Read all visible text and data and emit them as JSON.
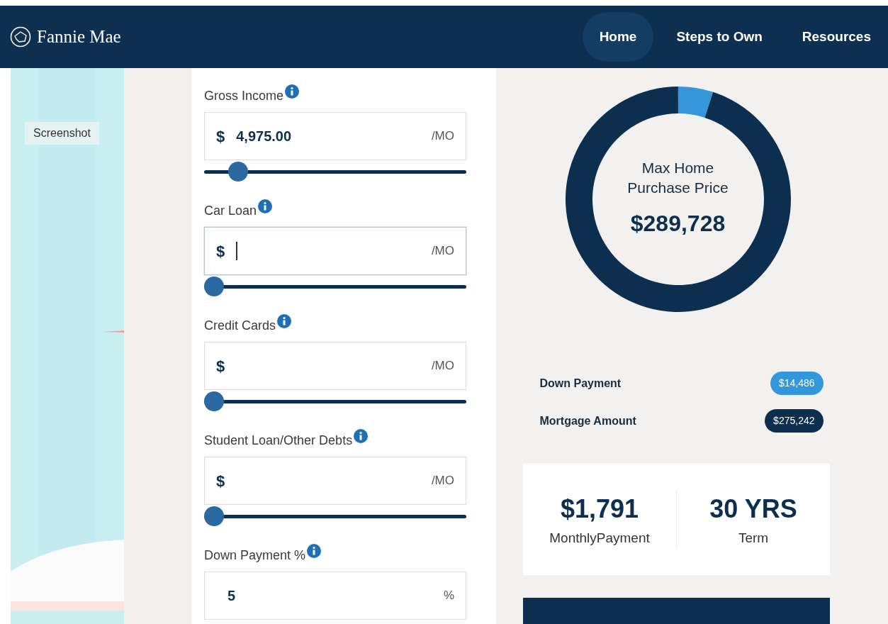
{
  "header": {
    "logo": "Fannie Mae",
    "nav": [
      {
        "label": "Home",
        "selected": true
      },
      {
        "label": "Steps to Own",
        "selected": false
      },
      {
        "label": "Resources",
        "selected": false
      }
    ]
  },
  "sidebar": {
    "label": "Screenshot"
  },
  "form": {
    "fields": [
      {
        "label": "Gross Income",
        "prefix": "$",
        "value": "4,975.00",
        "suffix": "/MO",
        "focused": false,
        "level": 0.1
      },
      {
        "label": "Car Loan",
        "prefix": "$",
        "suffix": "/MO",
        "focused": true,
        "level": 0
      },
      {
        "label": "Credit Cards",
        "prefix": "$",
        "suffix": "/MO",
        "focused": false,
        "level": 0
      },
      {
        "label": "Student Loan/Other Debts",
        "prefix": "$",
        "suffix": "/MO",
        "focused": false,
        "level": 0
      },
      {
        "label": "Down Payment %",
        "value": "5",
        "suffix": "%",
        "focused": false
      }
    ]
  },
  "summary": {
    "center_label": "Max Home Purchase Price",
    "center_value": "$289,728",
    "chart_data": {
      "type": "donut",
      "categories": [
        "Down Payment",
        "Mortgage Amount"
      ],
      "series": [
        {
          "values": [
            5,
            95
          ]
        }
      ]
    },
    "legend": [
      {
        "value": "$14,486",
        "color": "#3597db"
      },
      {
        "value": "$275,242",
        "color": "#0d2f4f"
      }
    ],
    "stats": [
      {
        "value": "$1,791",
        "label": "MonthlyPayment"
      },
      {
        "value": "30 YRS",
        "label": "Term"
      }
    ]
  }
}
